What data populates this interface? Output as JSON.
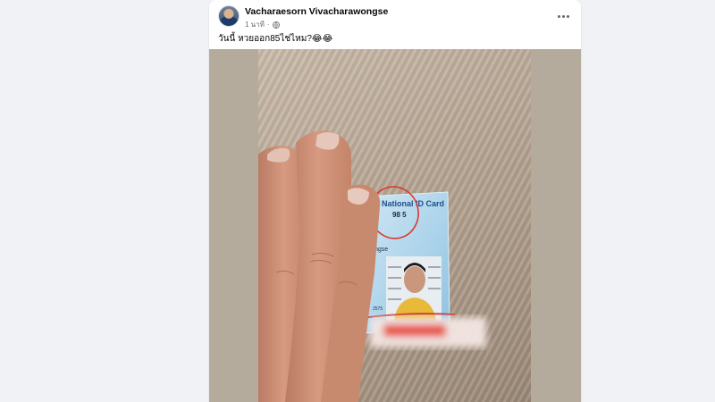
{
  "post": {
    "author": "Vacharaesorn Vivacharawongse",
    "time": "1 นาที",
    "separator": "·",
    "text": "วันนี้ หวยออก85ไช่ไหม?😂😂"
  },
  "icons": {
    "avatar": "profile-photo",
    "privacy": "globe-icon",
    "menu": "more-options-icon"
  },
  "photo": {
    "card_title": "National ID Card",
    "card_number": "98 5",
    "card_name_fragment": "ngse",
    "card_small_text": "2575",
    "annotation_color": "#e0352b"
  }
}
